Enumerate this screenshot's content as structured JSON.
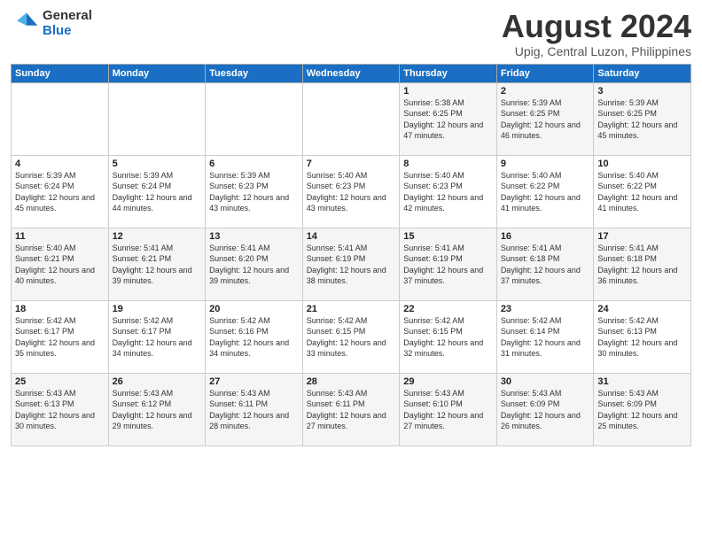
{
  "header": {
    "logo_general": "General",
    "logo_blue": "Blue",
    "month": "August 2024",
    "location": "Upig, Central Luzon, Philippines"
  },
  "days_of_week": [
    "Sunday",
    "Monday",
    "Tuesday",
    "Wednesday",
    "Thursday",
    "Friday",
    "Saturday"
  ],
  "weeks": [
    [
      {
        "day": "",
        "sunrise": "",
        "sunset": "",
        "daylight": ""
      },
      {
        "day": "",
        "sunrise": "",
        "sunset": "",
        "daylight": ""
      },
      {
        "day": "",
        "sunrise": "",
        "sunset": "",
        "daylight": ""
      },
      {
        "day": "",
        "sunrise": "",
        "sunset": "",
        "daylight": ""
      },
      {
        "day": "1",
        "sunrise": "5:38 AM",
        "sunset": "6:25 PM",
        "daylight": "12 hours and 47 minutes."
      },
      {
        "day": "2",
        "sunrise": "5:39 AM",
        "sunset": "6:25 PM",
        "daylight": "12 hours and 46 minutes."
      },
      {
        "day": "3",
        "sunrise": "5:39 AM",
        "sunset": "6:25 PM",
        "daylight": "12 hours and 45 minutes."
      }
    ],
    [
      {
        "day": "4",
        "sunrise": "5:39 AM",
        "sunset": "6:24 PM",
        "daylight": "12 hours and 45 minutes."
      },
      {
        "day": "5",
        "sunrise": "5:39 AM",
        "sunset": "6:24 PM",
        "daylight": "12 hours and 44 minutes."
      },
      {
        "day": "6",
        "sunrise": "5:39 AM",
        "sunset": "6:23 PM",
        "daylight": "12 hours and 43 minutes."
      },
      {
        "day": "7",
        "sunrise": "5:40 AM",
        "sunset": "6:23 PM",
        "daylight": "12 hours and 43 minutes."
      },
      {
        "day": "8",
        "sunrise": "5:40 AM",
        "sunset": "6:23 PM",
        "daylight": "12 hours and 42 minutes."
      },
      {
        "day": "9",
        "sunrise": "5:40 AM",
        "sunset": "6:22 PM",
        "daylight": "12 hours and 41 minutes."
      },
      {
        "day": "10",
        "sunrise": "5:40 AM",
        "sunset": "6:22 PM",
        "daylight": "12 hours and 41 minutes."
      }
    ],
    [
      {
        "day": "11",
        "sunrise": "5:40 AM",
        "sunset": "6:21 PM",
        "daylight": "12 hours and 40 minutes."
      },
      {
        "day": "12",
        "sunrise": "5:41 AM",
        "sunset": "6:21 PM",
        "daylight": "12 hours and 39 minutes."
      },
      {
        "day": "13",
        "sunrise": "5:41 AM",
        "sunset": "6:20 PM",
        "daylight": "12 hours and 39 minutes."
      },
      {
        "day": "14",
        "sunrise": "5:41 AM",
        "sunset": "6:19 PM",
        "daylight": "12 hours and 38 minutes."
      },
      {
        "day": "15",
        "sunrise": "5:41 AM",
        "sunset": "6:19 PM",
        "daylight": "12 hours and 37 minutes."
      },
      {
        "day": "16",
        "sunrise": "5:41 AM",
        "sunset": "6:18 PM",
        "daylight": "12 hours and 37 minutes."
      },
      {
        "day": "17",
        "sunrise": "5:41 AM",
        "sunset": "6:18 PM",
        "daylight": "12 hours and 36 minutes."
      }
    ],
    [
      {
        "day": "18",
        "sunrise": "5:42 AM",
        "sunset": "6:17 PM",
        "daylight": "12 hours and 35 minutes."
      },
      {
        "day": "19",
        "sunrise": "5:42 AM",
        "sunset": "6:17 PM",
        "daylight": "12 hours and 34 minutes."
      },
      {
        "day": "20",
        "sunrise": "5:42 AM",
        "sunset": "6:16 PM",
        "daylight": "12 hours and 34 minutes."
      },
      {
        "day": "21",
        "sunrise": "5:42 AM",
        "sunset": "6:15 PM",
        "daylight": "12 hours and 33 minutes."
      },
      {
        "day": "22",
        "sunrise": "5:42 AM",
        "sunset": "6:15 PM",
        "daylight": "12 hours and 32 minutes."
      },
      {
        "day": "23",
        "sunrise": "5:42 AM",
        "sunset": "6:14 PM",
        "daylight": "12 hours and 31 minutes."
      },
      {
        "day": "24",
        "sunrise": "5:42 AM",
        "sunset": "6:13 PM",
        "daylight": "12 hours and 30 minutes."
      }
    ],
    [
      {
        "day": "25",
        "sunrise": "5:43 AM",
        "sunset": "6:13 PM",
        "daylight": "12 hours and 30 minutes."
      },
      {
        "day": "26",
        "sunrise": "5:43 AM",
        "sunset": "6:12 PM",
        "daylight": "12 hours and 29 minutes."
      },
      {
        "day": "27",
        "sunrise": "5:43 AM",
        "sunset": "6:11 PM",
        "daylight": "12 hours and 28 minutes."
      },
      {
        "day": "28",
        "sunrise": "5:43 AM",
        "sunset": "6:11 PM",
        "daylight": "12 hours and 27 minutes."
      },
      {
        "day": "29",
        "sunrise": "5:43 AM",
        "sunset": "6:10 PM",
        "daylight": "12 hours and 27 minutes."
      },
      {
        "day": "30",
        "sunrise": "5:43 AM",
        "sunset": "6:09 PM",
        "daylight": "12 hours and 26 minutes."
      },
      {
        "day": "31",
        "sunrise": "5:43 AM",
        "sunset": "6:09 PM",
        "daylight": "12 hours and 25 minutes."
      }
    ]
  ]
}
